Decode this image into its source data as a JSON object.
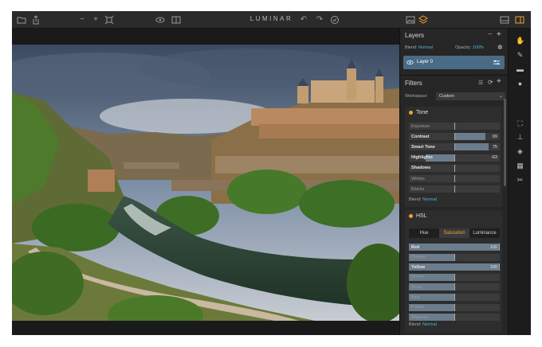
{
  "app": {
    "title": "LUMINAR"
  },
  "toolbar": {
    "left_icons": [
      "folder-icon",
      "share-icon",
      "zoom-out-icon",
      "zoom-in-icon",
      "fit-icon",
      "eye-icon",
      "compare-icon"
    ],
    "undo_icon": "undo-icon",
    "redo_icon": "redo-icon",
    "history_icon": "history-icon",
    "right_icons": [
      "image-icon",
      "layers-icon",
      "panel-icon",
      "sidebar-icon"
    ]
  },
  "layers": {
    "title": "Layers",
    "blend_label": "Blend:",
    "blend_value": "Normal",
    "opacity_label": "Opacity:",
    "opacity_value": "100%",
    "layer_name": "Layer 0"
  },
  "filters": {
    "title": "Filters",
    "workspace_label": "Workspace:",
    "workspace_value": "Custom"
  },
  "tone": {
    "title": "Tone",
    "sliders": [
      {
        "label": "Exposure",
        "value": "",
        "level": 0
      },
      {
        "label": "Contrast",
        "value": "69",
        "level": 69
      },
      {
        "label": "Smart Tone",
        "value": "75",
        "level": 75
      },
      {
        "label": "Highlights",
        "value": "-63",
        "level": -63
      },
      {
        "label": "Shadows",
        "value": "",
        "level": 0
      },
      {
        "label": "Whites",
        "value": "",
        "level": 0
      },
      {
        "label": "Blacks",
        "value": "",
        "level": 0
      }
    ],
    "blend_label": "Blend:",
    "blend_value": "Normal"
  },
  "hsl": {
    "title": "HSL",
    "tabs": [
      "Hue",
      "Saturation",
      "Luminance"
    ],
    "active_tab": "Saturation",
    "sliders": [
      {
        "label": "Red",
        "value": "100",
        "level": 100
      },
      {
        "label": "Orange",
        "value": "",
        "level": 0
      },
      {
        "label": "Yellow",
        "value": "100",
        "level": 100
      },
      {
        "label": "Green",
        "value": "",
        "level": 0
      },
      {
        "label": "Aqua",
        "value": "",
        "level": 0
      },
      {
        "label": "Blue",
        "value": "",
        "level": 0
      },
      {
        "label": "Purple",
        "value": "",
        "level": 0
      },
      {
        "label": "Magenta",
        "value": "",
        "level": 0
      }
    ],
    "blend_label": "Blend:",
    "blend_value": "Normal"
  },
  "tools": [
    "filters-tool-icon",
    "brush-icon",
    "gradient-icon",
    "radial-icon",
    "crop-icon",
    "clone-stamp-icon",
    "erase-icon",
    "texture-icon",
    "transform-icon"
  ],
  "colors": {
    "accent": "#4fb3d9",
    "orange": "#f0a030",
    "panel": "#262626",
    "selected_layer": "#4a6b86"
  }
}
